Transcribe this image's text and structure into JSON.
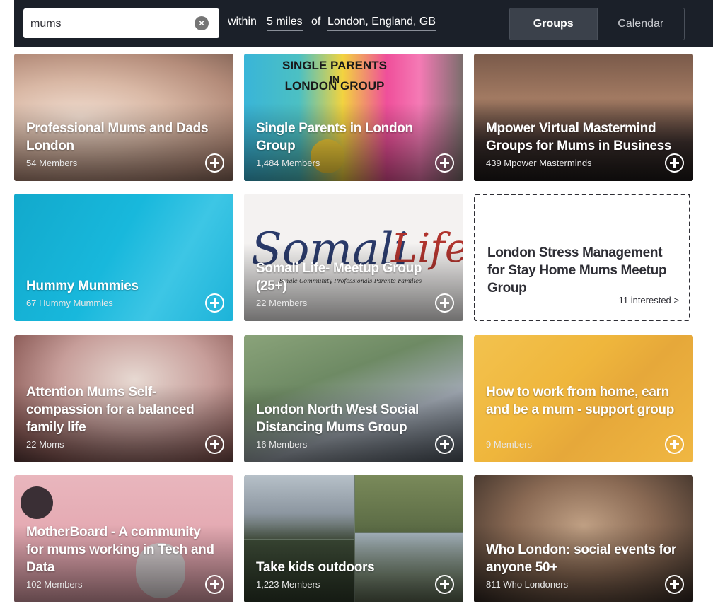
{
  "search": {
    "query": "mums",
    "clear_symbol": "×",
    "within_label": "within",
    "distance": "5 miles",
    "of_label": "of",
    "location": "London, England, GB"
  },
  "view_toggle": {
    "groups_label": "Groups",
    "calendar_label": "Calendar",
    "selected": "Groups"
  },
  "groups": [
    {
      "title": "Professional Mums and Dads London",
      "meta": "54 Members",
      "action_icon": "plus-circle-icon"
    },
    {
      "title": "Single Parents in London Group",
      "meta": "1,484 Members",
      "action_icon": "plus-circle-icon",
      "image_text": "SINGLE PARENTS IN LONDON GROUP"
    },
    {
      "title": "Mpower Virtual Mastermind Groups for Mums in Business",
      "meta": "439 Mpower Masterminds",
      "action_icon": "plus-circle-icon"
    },
    {
      "title": "Hummy Mummies",
      "meta": "67 Hummy Mummies",
      "action_icon": "plus-circle-icon",
      "color": "#00b6e0"
    },
    {
      "title": "Somali Life- Meetup Group (25+)",
      "meta": "22 Members",
      "action_icon": "plus-circle-icon",
      "image_text": "Somali Life",
      "image_subtext": "Single Community Professionals Parents Families"
    },
    {
      "title": "London Stress Management for Stay Home Mums Meetup Group",
      "meta": "11 interested >",
      "style": "dashed"
    },
    {
      "title": "Attention Mums Self-compassion for a balanced family life",
      "meta": "22 Moms",
      "action_icon": "plus-circle-icon"
    },
    {
      "title": "London North West Social Distancing Mums Group",
      "meta": "16 Members",
      "action_icon": "plus-circle-icon"
    },
    {
      "title": "How to work from home, earn and be a mum - support group",
      "meta": "9 Members",
      "action_icon": "plus-circle-icon",
      "color": "#efb63c"
    },
    {
      "title": "MotherBoard - A community for mums working in Tech and Data",
      "meta": "102 Members",
      "action_icon": "plus-circle-icon"
    },
    {
      "title": "Take kids outdoors",
      "meta": "1,223 Members",
      "action_icon": "plus-circle-icon"
    },
    {
      "title": "Who London: social events for anyone 50+",
      "meta": "811 Who Londoners",
      "action_icon": "plus-circle-icon"
    }
  ]
}
